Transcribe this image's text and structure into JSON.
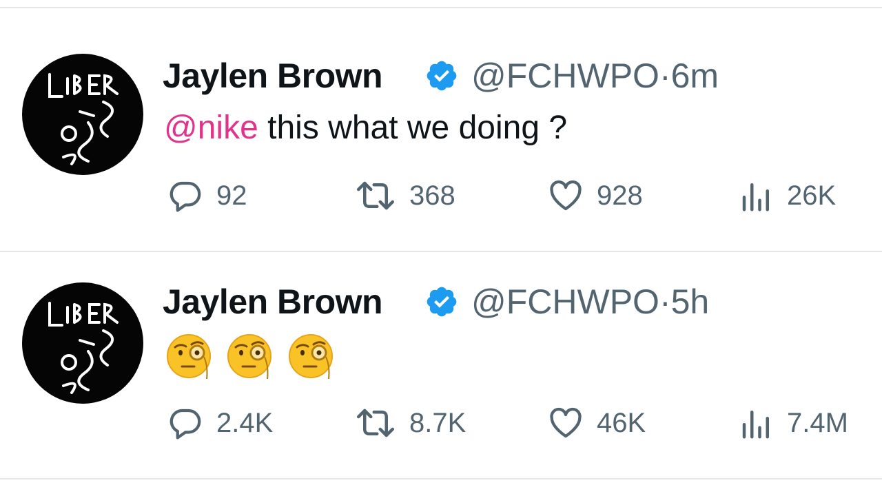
{
  "tweets": [
    {
      "author": "Jaylen Brown",
      "handle": "@FCHWPO",
      "separator": "·",
      "time": "6m",
      "mention": "@nike",
      "text": " this what we doing ?",
      "emojis": [],
      "stats": {
        "replies": "92",
        "retweets": "368",
        "likes": "928",
        "views": "26K"
      }
    },
    {
      "author": "Jaylen Brown",
      "handle": "@FCHWPO",
      "separator": "·",
      "time": "5h",
      "mention": "",
      "text": "",
      "emojis": [
        "face-with-monocle",
        "face-with-monocle",
        "face-with-monocle"
      ],
      "stats": {
        "replies": "2.4K",
        "retweets": "8.7K",
        "likes": "46K",
        "views": "7.4M"
      }
    }
  ],
  "avatar_text": "LIBERATION",
  "colors": {
    "verified": "#1d9bf0",
    "mention": "#e0348a",
    "muted": "#536471"
  },
  "icons": [
    "reply-icon",
    "retweet-icon",
    "like-icon",
    "views-icon",
    "verified-badge-icon"
  ]
}
